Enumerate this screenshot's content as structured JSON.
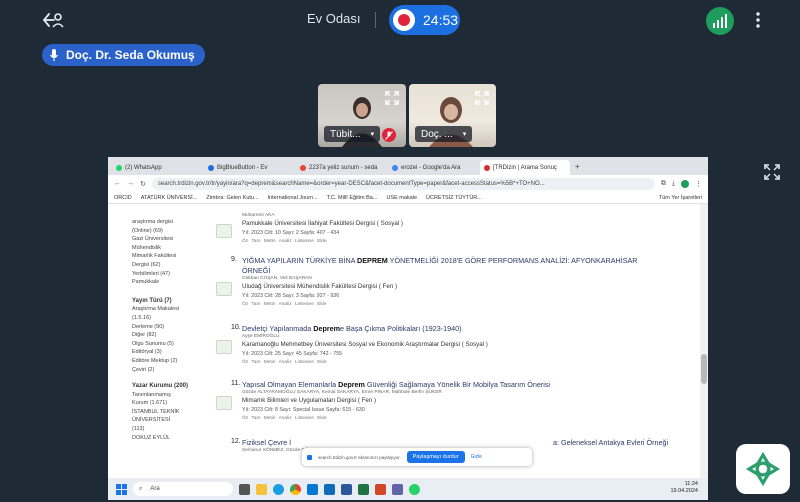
{
  "header": {
    "room_name": "Ev Odası",
    "timer": "24:53"
  },
  "presenter": {
    "name": "Doç. Dr. Seda Okumuş"
  },
  "participants": [
    {
      "name": "Tübit..."
    },
    {
      "name": "Doç. ..."
    }
  ],
  "browser": {
    "tabs": [
      {
        "label": "(2) WhatsApp",
        "color": "#25d366"
      },
      {
        "label": "BigBlueButton - Ev",
        "color": "#1b6fe0"
      },
      {
        "label": "2237a yeliz sunum - seda",
        "color": "#ea4335"
      },
      {
        "label": "erozei - Google'da Ara",
        "color": "#4285f4"
      },
      {
        "label": "[TRDizin | Arama Sonuç",
        "color": "#d32f2f"
      }
    ],
    "url": "search.trdizin.gov.tr/tr/yayin/ara?q=deprem&searchName=&order=year-DESC&facet-documentType=paper&facet-accessStatus=%5B*+TO+NO...",
    "bookmarks": [
      "ORCID",
      "ATATÜRK ÜNİVERSİ...",
      "Zimbra: Gelen Kutu...",
      "International Journ...",
      "T.C. Millî Eğitim Ba...",
      "USE makale",
      "ÜCRETSİZ TÜYTÜR..."
    ],
    "all_bookmarks": "Tüm Yer İşaretleri"
  },
  "sidebar": {
    "topic_items": [
      "araştırma dergisi",
      "(Online) (69)",
      "Gazi Üniversitesi",
      "Mühendislik",
      "Mimarlık Fakültesi",
      "Dergisi (62)",
      "Yerbilimleri (47)",
      "Pamukkale"
    ],
    "type_heading": "Yayın Türü (7)",
    "type_items": [
      "Araştırma Makalesi",
      "(1.5.16)",
      "Derleme (90)",
      "Diğer (82)",
      "Olgu Sunumu (5)",
      "Editöryal (3)",
      "Editöre Mektup (2)",
      "Çeviri (2)"
    ],
    "institution_heading": "Yazar Kurumu (200)",
    "institution_items": [
      "Tanımlanmamış",
      "Kurum (1.671)",
      "İSTANBUL TEKNİK",
      "ÜNİVERSİTESİ",
      "(113)",
      "DOKUZ EYLÜL"
    ]
  },
  "results": [
    {
      "num": "",
      "title_pre": "",
      "title_bold": "",
      "title_post": "",
      "authors": "Muharrem AKA",
      "journal": "Pamukkale Üniversitesi İlahiyat Fakültesi Dergisi ( Sosyal )",
      "meta": "Yıl: 2023    Cilt: 10    Sayı: 2    Sayfa: 407 - 434",
      "actions": "Öz   Tam Metin   Analiz Listesine Ekle"
    },
    {
      "num": "9.",
      "title_pre": "YIĞMA YAPILARIN TÜRKİYE BİNA ",
      "title_bold": "DEPREM",
      "title_post": " YÖNETMELİĞİ 2018'E GÖRE PERFORMANS ANALİZİ: AFYONKARAHİSAR",
      "title_line2": "ÖRNEĞİ",
      "authors": "Gökhan COŞAN,     Veli BAŞARAN",
      "journal": "Uludağ Üniversitesi Mühendislik Fakültesi Dergisi ( Fen )",
      "meta": "Yıl: 2023    Cilt: 28    Sayı: 3    Sayfa: 927 - 936",
      "actions": "Öz   Tam Metin   Analiz Listesine Ekle"
    },
    {
      "num": "10.",
      "title_pre": "Devletçi Yapılanmada ",
      "title_bold": "Deprem",
      "title_post": "e Başa Çıkma Politikaları (1923-1940)",
      "authors": "Ayşe EMİROĞLU",
      "journal": "Karamanoğlu Mehmetbey Üniversitesi Sosyal ve Ekonomik Araştırmalar Dergisi ( Sosyal )",
      "meta": "Yıl: 2023    Cilt: 25    Sayı: 45    Sayfa: 742 - 755",
      "actions": "Öz   Tam Metin   Analiz Listesine Ekle"
    },
    {
      "num": "11.",
      "title_pre": "Yapısal Olmayan Elemanlarla ",
      "title_bold": "Deprem",
      "title_post": " Güvenliği Sağlamaya Yönelik Bir Mobilya Tasarım Önerisi",
      "authors": "Gözde ALTAYRAMOĞLU SAKARYA,     Kemal SAKARYA,     Emre PINAR,     Mahbule Berfin ŞÜKER",
      "journal": "Mimarlık Bilimleri ve Uygulamaları Dergisi ( Fen )",
      "meta": "Yıl: 2023    Cilt: 8    Sayı: Special Issue    Sayfa: 615 - 630",
      "actions": "Öz   Tam Metin   Analiz Listesine Ekle"
    },
    {
      "num": "12.",
      "title_pre": "Fiziksel Çevre İ",
      "title_bold": "",
      "title_post": "",
      "title_tail": "a: Geleneksel Antakya Evleri Örneği",
      "authors": "Semanur SÖNMEZ,     Gözde GÜLRE",
      "journal": "",
      "meta": "",
      "actions": ""
    }
  ],
  "share_bar": {
    "message": "search.trdizin.gov.tr ekranınızı paylaşıyor.",
    "stop_label": "Paylaşmayı durdur",
    "hide_label": "Gizle"
  },
  "taskbar": {
    "search_placeholder": "Ara",
    "time": "11:24",
    "date": "19.04.2024"
  }
}
